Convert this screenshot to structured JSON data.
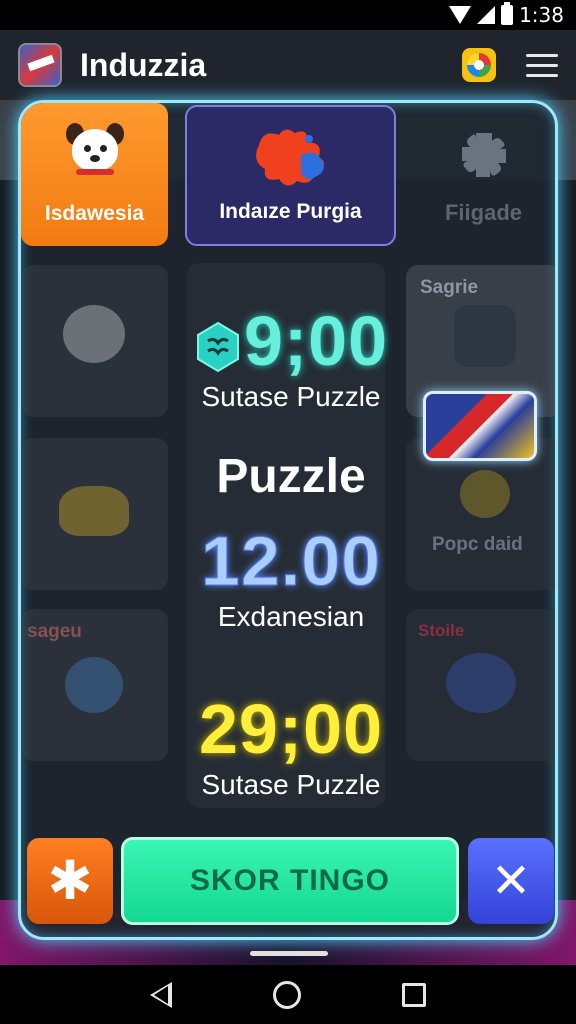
{
  "status_bar": {
    "time": "1:38"
  },
  "app_bar": {
    "title": "Induzzia"
  },
  "tiles": {
    "a": {
      "label": "Isdawesia"
    },
    "b": {
      "label": "Indaıze Purgia"
    },
    "c": {
      "label": "Fiigade"
    }
  },
  "faded_tiles": {
    "right_top_label": "Sagrie",
    "right_mid_label": "Popc daid",
    "left_bottom_label": "sageu",
    "right_bottom_label": "Stoile"
  },
  "scores": [
    {
      "value": "9;00",
      "caption": "Sutase Puzzle",
      "color": "#66f0dc"
    },
    {
      "value": "12.00",
      "caption": "Exdanesian",
      "color": "#a8cfff"
    },
    {
      "value": "29;00",
      "caption": "Sutase Puzzle",
      "color": "#ffee3a"
    }
  ],
  "center_title": "Puzzle",
  "buttons": {
    "primary_label": "SKOR TINGO",
    "star_glyph": "✱",
    "close_glyph": "✕"
  },
  "colors": {
    "accent_cyan": "#9fe6ff",
    "orange": "#f27b12",
    "green": "#14d890",
    "blue": "#3442d8"
  }
}
